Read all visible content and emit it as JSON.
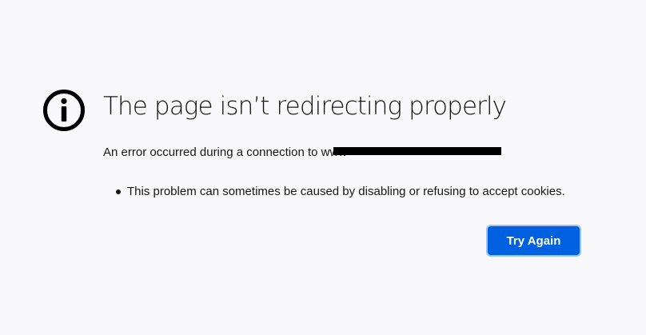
{
  "error": {
    "icon": "info-icon",
    "title": "The page isn’t redirecting properly",
    "description": "An error occurred during a connection to www",
    "redacted_host": true,
    "reasons": [
      "This problem can sometimes be caused by disabling or refusing to accept cookies."
    ],
    "try_again_label": "Try Again"
  },
  "colors": {
    "background": "#f9f9fb",
    "text": "#15141a",
    "button": "#0061e0",
    "button_focus_ring": "#9ac2f5"
  }
}
